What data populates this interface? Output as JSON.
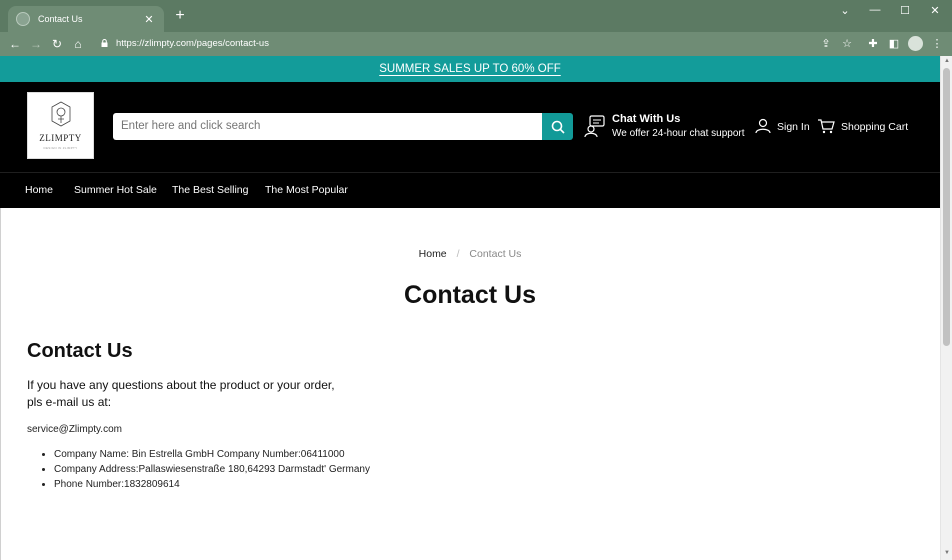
{
  "browser": {
    "tab_title": "Contact Us",
    "url": "https://zlimpty.com/pages/contact-us"
  },
  "promo": {
    "text": "SUMMER SALES UP TO 60% OFF"
  },
  "header": {
    "logo_text": "ZLIMPTY",
    "logo_sub": "DESIGN IN ZLIMPTY",
    "search_placeholder": "Enter here and click search",
    "chat_title": "Chat With Us",
    "chat_subtitle": "We offer 24-hour chat support",
    "sign_in": "Sign In",
    "cart": "Shopping Cart"
  },
  "nav": {
    "items": [
      {
        "label": "Home"
      },
      {
        "label": "Summer Hot Sale"
      },
      {
        "label": "The Best Selling"
      },
      {
        "label": "The Most Popular"
      }
    ]
  },
  "breadcrumb": {
    "home": "Home",
    "separator": "/",
    "current": "Contact Us"
  },
  "content": {
    "page_title": "Contact Us",
    "section_title": "Contact Us",
    "intro": "If you have any questions about the product or your order, pls e-mail us at:",
    "email": "service@Zlimpty.com",
    "info": [
      "Company Name: Bin Estrella GmbH Company Number:06411000",
      "Company Address:Pallaswiesenstraße 180,64293 Darmstadt' Germany",
      "Phone Number:1832809614"
    ]
  },
  "colors": {
    "accent": "#139c9a",
    "header_bg": "#000000",
    "chrome": "#6f8c75"
  }
}
